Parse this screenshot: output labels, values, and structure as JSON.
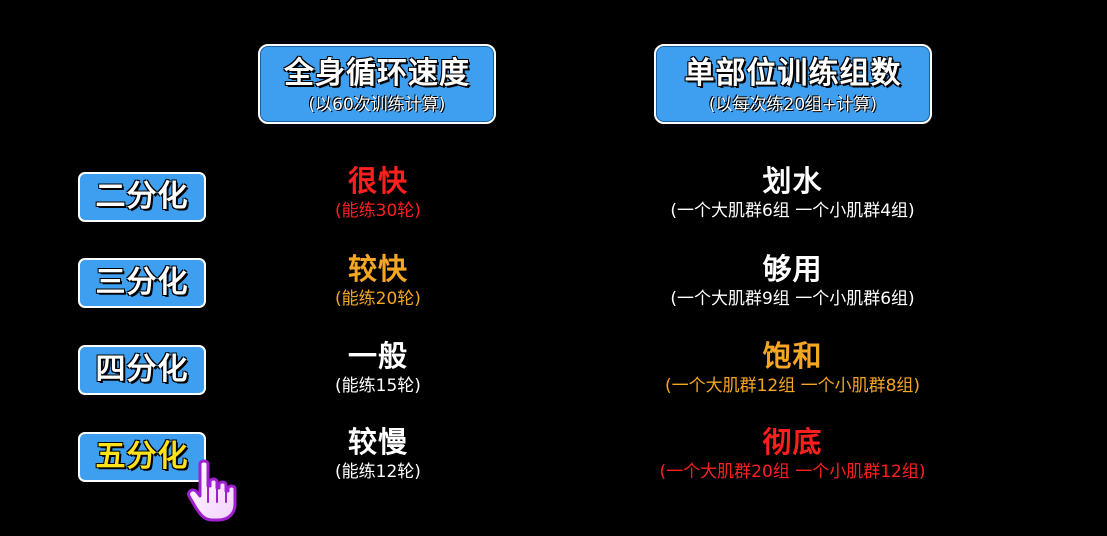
{
  "headers": {
    "speed": {
      "title": "全身循环速度",
      "sub": "(以60次训练计算)"
    },
    "sets": {
      "title": "单部位训练组数",
      "sub": "(以每次练20组+计算)"
    }
  },
  "rows": [
    {
      "label": "二分化",
      "speed_main": "很快",
      "speed_note": "(能练30轮)",
      "sets_main": "划水",
      "sets_note": "(一个大肌群6组 一个小肌群4组)"
    },
    {
      "label": "三分化",
      "speed_main": "较快",
      "speed_note": "(能练20轮)",
      "sets_main": "够用",
      "sets_note": "(一个大肌群9组 一个小肌群6组)"
    },
    {
      "label": "四分化",
      "speed_main": "一般",
      "speed_note": "(能练15轮)",
      "sets_main": "饱和",
      "sets_note": "(一个大肌群12组 一个小肌群8组)"
    },
    {
      "label": "五分化",
      "speed_main": "较慢",
      "speed_note": "(能练12轮)",
      "sets_main": "彻底",
      "sets_note": "(一个大肌群20组 一个小肌群12组)"
    }
  ],
  "colors": {
    "header_bg": "#3e9ff0",
    "red": "#ff1f1f",
    "orange": "#f5a623",
    "white": "#ffffff",
    "highlight": "#ffe21a"
  },
  "cursor_icon": "hand-pointer-icon"
}
